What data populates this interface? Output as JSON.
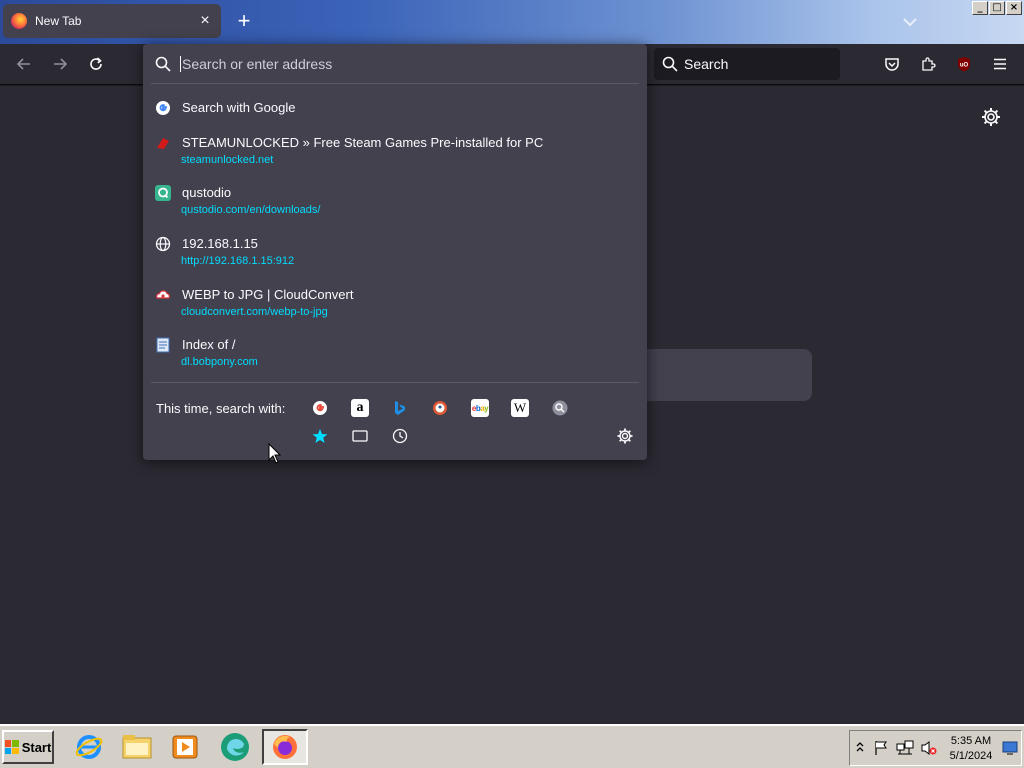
{
  "tab": {
    "title": "New Tab",
    "close_glyph": "×"
  },
  "new_tab_glyph": "+",
  "window_controls": [
    "_",
    "□",
    "×"
  ],
  "toolbar": {
    "search_placeholder": "Search"
  },
  "urlbar": {
    "placeholder": "Search or enter address",
    "results": [
      {
        "title": "Search with Google",
        "url": "",
        "icon": "google-icon"
      },
      {
        "title": "STEAMUNLOCKED » Free Steam Games Pre-installed for PC",
        "url": "steamunlocked.net",
        "icon": "steamunlocked-icon"
      },
      {
        "title": "qustodio",
        "url": "qustodio.com/en/downloads/",
        "icon": "qustodio-icon"
      },
      {
        "title": "192.168.1.15",
        "url": "http://192.168.1.15:912",
        "icon": "globe-icon"
      },
      {
        "title": "WEBP to JPG | CloudConvert",
        "url": "cloudconvert.com/webp-to-jpg",
        "icon": "cloudconvert-icon"
      },
      {
        "title": "Index of /",
        "url": "dl.bobpony.com",
        "icon": "document-icon"
      }
    ],
    "one_time_label": "This time, search with:",
    "engines": [
      "google",
      "amazon",
      "bing",
      "duckduckgo",
      "ebay",
      "wikipedia",
      "search"
    ],
    "local_sources": [
      "bookmarks",
      "tabs",
      "history"
    ]
  },
  "taskbar": {
    "start_label": "Start",
    "apps": [
      "internet-explorer",
      "file-explorer",
      "media-player",
      "edge",
      "firefox"
    ],
    "clock_time": "5:35 AM",
    "clock_date": "5/1/2024"
  },
  "colors": {
    "accent": "#00ddff",
    "panel": "#42414d",
    "toolbar": "#2b2a33"
  }
}
